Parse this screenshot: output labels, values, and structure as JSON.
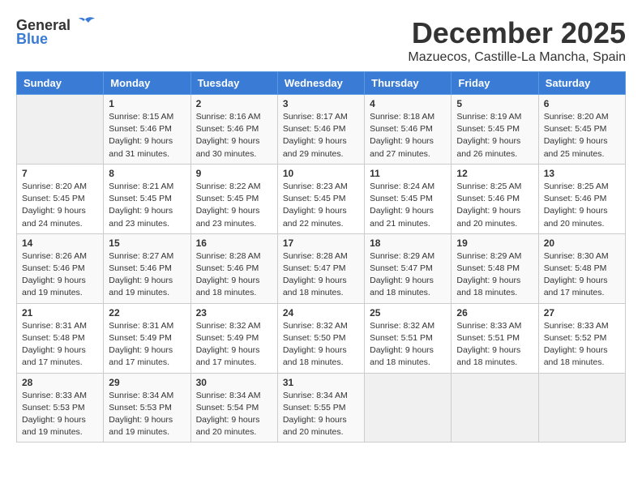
{
  "logo": {
    "general": "General",
    "blue": "Blue"
  },
  "title": "December 2025",
  "location": "Mazuecos, Castille-La Mancha, Spain",
  "headers": [
    "Sunday",
    "Monday",
    "Tuesday",
    "Wednesday",
    "Thursday",
    "Friday",
    "Saturday"
  ],
  "weeks": [
    [
      {
        "day": "",
        "info": ""
      },
      {
        "day": "1",
        "info": "Sunrise: 8:15 AM\nSunset: 5:46 PM\nDaylight: 9 hours\nand 31 minutes."
      },
      {
        "day": "2",
        "info": "Sunrise: 8:16 AM\nSunset: 5:46 PM\nDaylight: 9 hours\nand 30 minutes."
      },
      {
        "day": "3",
        "info": "Sunrise: 8:17 AM\nSunset: 5:46 PM\nDaylight: 9 hours\nand 29 minutes."
      },
      {
        "day": "4",
        "info": "Sunrise: 8:18 AM\nSunset: 5:46 PM\nDaylight: 9 hours\nand 27 minutes."
      },
      {
        "day": "5",
        "info": "Sunrise: 8:19 AM\nSunset: 5:45 PM\nDaylight: 9 hours\nand 26 minutes."
      },
      {
        "day": "6",
        "info": "Sunrise: 8:20 AM\nSunset: 5:45 PM\nDaylight: 9 hours\nand 25 minutes."
      }
    ],
    [
      {
        "day": "7",
        "info": "Sunrise: 8:20 AM\nSunset: 5:45 PM\nDaylight: 9 hours\nand 24 minutes."
      },
      {
        "day": "8",
        "info": "Sunrise: 8:21 AM\nSunset: 5:45 PM\nDaylight: 9 hours\nand 23 minutes."
      },
      {
        "day": "9",
        "info": "Sunrise: 8:22 AM\nSunset: 5:45 PM\nDaylight: 9 hours\nand 23 minutes."
      },
      {
        "day": "10",
        "info": "Sunrise: 8:23 AM\nSunset: 5:45 PM\nDaylight: 9 hours\nand 22 minutes."
      },
      {
        "day": "11",
        "info": "Sunrise: 8:24 AM\nSunset: 5:45 PM\nDaylight: 9 hours\nand 21 minutes."
      },
      {
        "day": "12",
        "info": "Sunrise: 8:25 AM\nSunset: 5:46 PM\nDaylight: 9 hours\nand 20 minutes."
      },
      {
        "day": "13",
        "info": "Sunrise: 8:25 AM\nSunset: 5:46 PM\nDaylight: 9 hours\nand 20 minutes."
      }
    ],
    [
      {
        "day": "14",
        "info": "Sunrise: 8:26 AM\nSunset: 5:46 PM\nDaylight: 9 hours\nand 19 minutes."
      },
      {
        "day": "15",
        "info": "Sunrise: 8:27 AM\nSunset: 5:46 PM\nDaylight: 9 hours\nand 19 minutes."
      },
      {
        "day": "16",
        "info": "Sunrise: 8:28 AM\nSunset: 5:46 PM\nDaylight: 9 hours\nand 18 minutes."
      },
      {
        "day": "17",
        "info": "Sunrise: 8:28 AM\nSunset: 5:47 PM\nDaylight: 9 hours\nand 18 minutes."
      },
      {
        "day": "18",
        "info": "Sunrise: 8:29 AM\nSunset: 5:47 PM\nDaylight: 9 hours\nand 18 minutes."
      },
      {
        "day": "19",
        "info": "Sunrise: 8:29 AM\nSunset: 5:48 PM\nDaylight: 9 hours\nand 18 minutes."
      },
      {
        "day": "20",
        "info": "Sunrise: 8:30 AM\nSunset: 5:48 PM\nDaylight: 9 hours\nand 17 minutes."
      }
    ],
    [
      {
        "day": "21",
        "info": "Sunrise: 8:31 AM\nSunset: 5:48 PM\nDaylight: 9 hours\nand 17 minutes."
      },
      {
        "day": "22",
        "info": "Sunrise: 8:31 AM\nSunset: 5:49 PM\nDaylight: 9 hours\nand 17 minutes."
      },
      {
        "day": "23",
        "info": "Sunrise: 8:32 AM\nSunset: 5:49 PM\nDaylight: 9 hours\nand 17 minutes."
      },
      {
        "day": "24",
        "info": "Sunrise: 8:32 AM\nSunset: 5:50 PM\nDaylight: 9 hours\nand 18 minutes."
      },
      {
        "day": "25",
        "info": "Sunrise: 8:32 AM\nSunset: 5:51 PM\nDaylight: 9 hours\nand 18 minutes."
      },
      {
        "day": "26",
        "info": "Sunrise: 8:33 AM\nSunset: 5:51 PM\nDaylight: 9 hours\nand 18 minutes."
      },
      {
        "day": "27",
        "info": "Sunrise: 8:33 AM\nSunset: 5:52 PM\nDaylight: 9 hours\nand 18 minutes."
      }
    ],
    [
      {
        "day": "28",
        "info": "Sunrise: 8:33 AM\nSunset: 5:53 PM\nDaylight: 9 hours\nand 19 minutes."
      },
      {
        "day": "29",
        "info": "Sunrise: 8:34 AM\nSunset: 5:53 PM\nDaylight: 9 hours\nand 19 minutes."
      },
      {
        "day": "30",
        "info": "Sunrise: 8:34 AM\nSunset: 5:54 PM\nDaylight: 9 hours\nand 20 minutes."
      },
      {
        "day": "31",
        "info": "Sunrise: 8:34 AM\nSunset: 5:55 PM\nDaylight: 9 hours\nand 20 minutes."
      },
      {
        "day": "",
        "info": ""
      },
      {
        "day": "",
        "info": ""
      },
      {
        "day": "",
        "info": ""
      }
    ]
  ]
}
